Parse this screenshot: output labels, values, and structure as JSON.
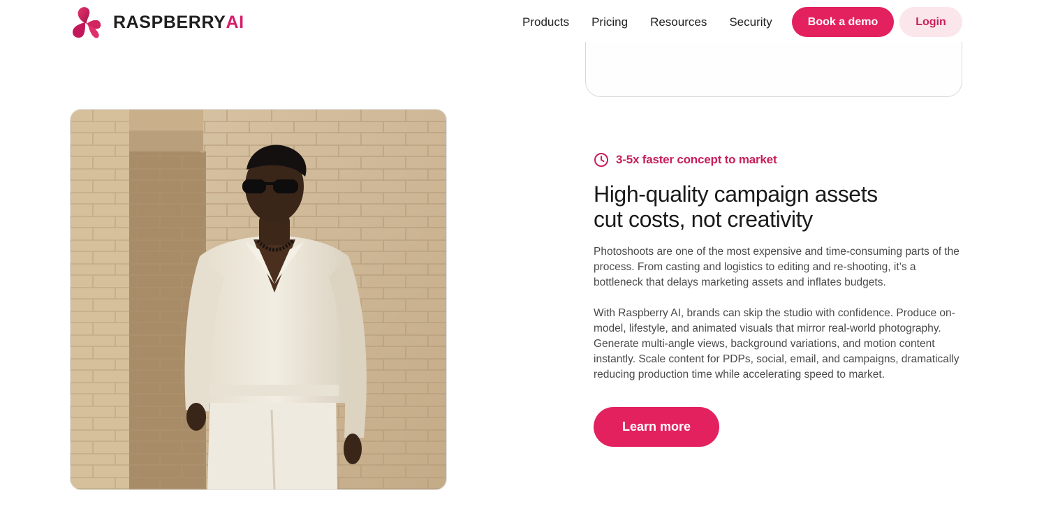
{
  "brand": {
    "name_main": "RASPBERRY",
    "name_accent": "AI",
    "primary_color": "#e3215f",
    "accent_text_color": "#c51f5b"
  },
  "nav": {
    "items": [
      {
        "label": "Products"
      },
      {
        "label": "Pricing"
      },
      {
        "label": "Resources"
      },
      {
        "label": "Security"
      }
    ],
    "demo_button": "Book a demo",
    "login_button": "Login"
  },
  "feature": {
    "eyebrow_icon": "clock-icon",
    "eyebrow": "3-5x faster concept to market",
    "headline_line1": "High-quality campaign assets",
    "headline_line2": "cut costs, not creativity",
    "paragraph1": "Photoshoots are one of the most expensive and time-consuming parts of the process. From casting and logistics to editing and re-shooting, it’s a bottleneck that delays marketing assets and inflates budgets.",
    "paragraph2": "With Raspberry AI, brands can skip the studio with confidence. Produce on-model, lifestyle, and animated visuals that mirror real-world photography. Generate multi-angle views, background variations, and motion content instantly. Scale content for PDPs, social, email, and campaigns, dramatically reducing production time while accelerating speed to market.",
    "cta": "Learn more"
  }
}
